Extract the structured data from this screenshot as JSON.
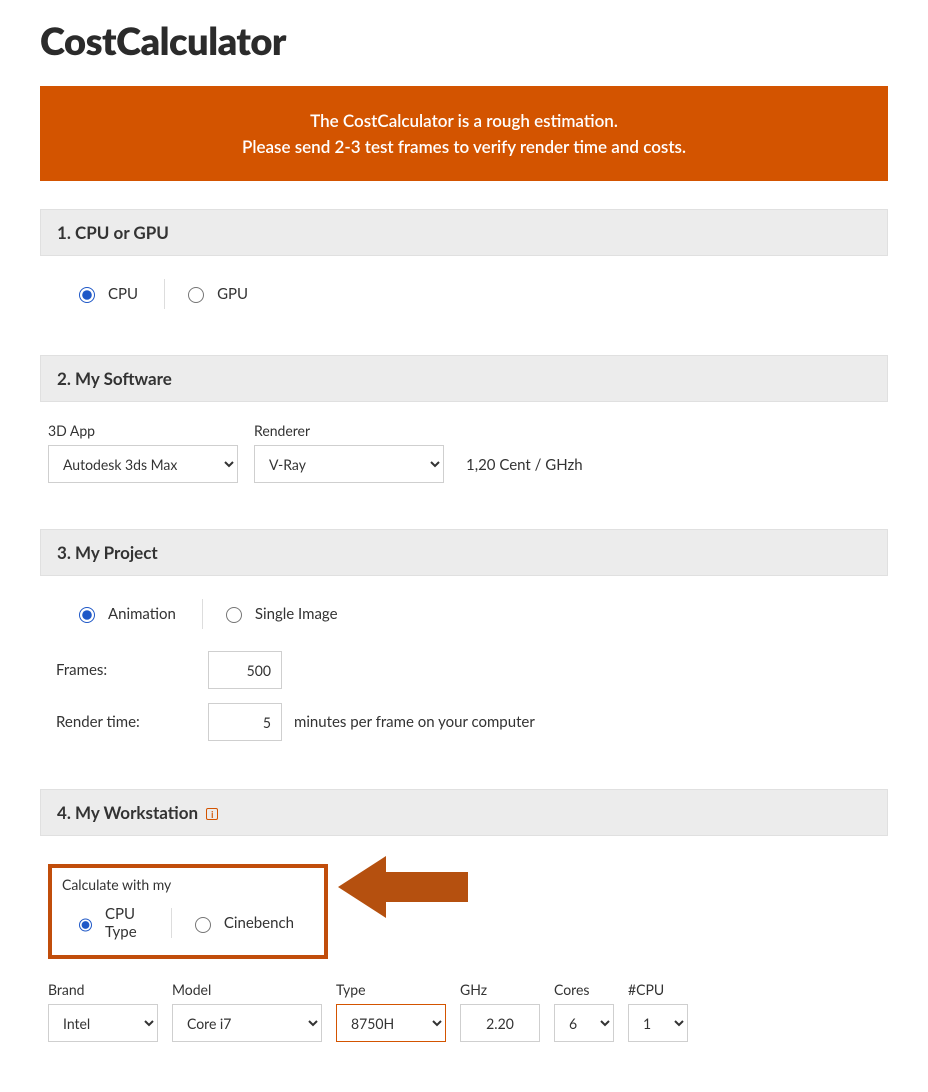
{
  "title": "CostCalculator",
  "alert": {
    "line1": "The CostCalculator is a rough estimation.",
    "line2": "Please send 2-3 test frames to verify render time and costs."
  },
  "section1": {
    "heading": "1. CPU or GPU",
    "opt_cpu": "CPU",
    "opt_gpu": "GPU"
  },
  "section2": {
    "heading": "2. My Software",
    "app_label": "3D App",
    "app_value": "Autodesk 3ds Max",
    "renderer_label": "Renderer",
    "renderer_value": "V-Ray",
    "price": "1,20 Cent / GHzh"
  },
  "section3": {
    "heading": "3. My Project",
    "opt_anim": "Animation",
    "opt_single": "Single Image",
    "frames_label": "Frames:",
    "frames_value": "500",
    "rtime_label": "Render time:",
    "rtime_value": "5",
    "rtime_suffix": "minutes per frame on your computer"
  },
  "section4": {
    "heading": "4. My Workstation",
    "calc_label": "Calculate with my",
    "opt_cputype": "CPU Type",
    "opt_cinebench": "Cinebench",
    "brand_label": "Brand",
    "brand_value": "Intel",
    "model_label": "Model",
    "model_value": "Core i7",
    "type_label": "Type",
    "type_value": "8750H",
    "ghz_label": "GHz",
    "ghz_value": "2.20",
    "cores_label": "Cores",
    "cores_value": "6",
    "ncpu_label": "#CPU",
    "ncpu_value": "1"
  }
}
